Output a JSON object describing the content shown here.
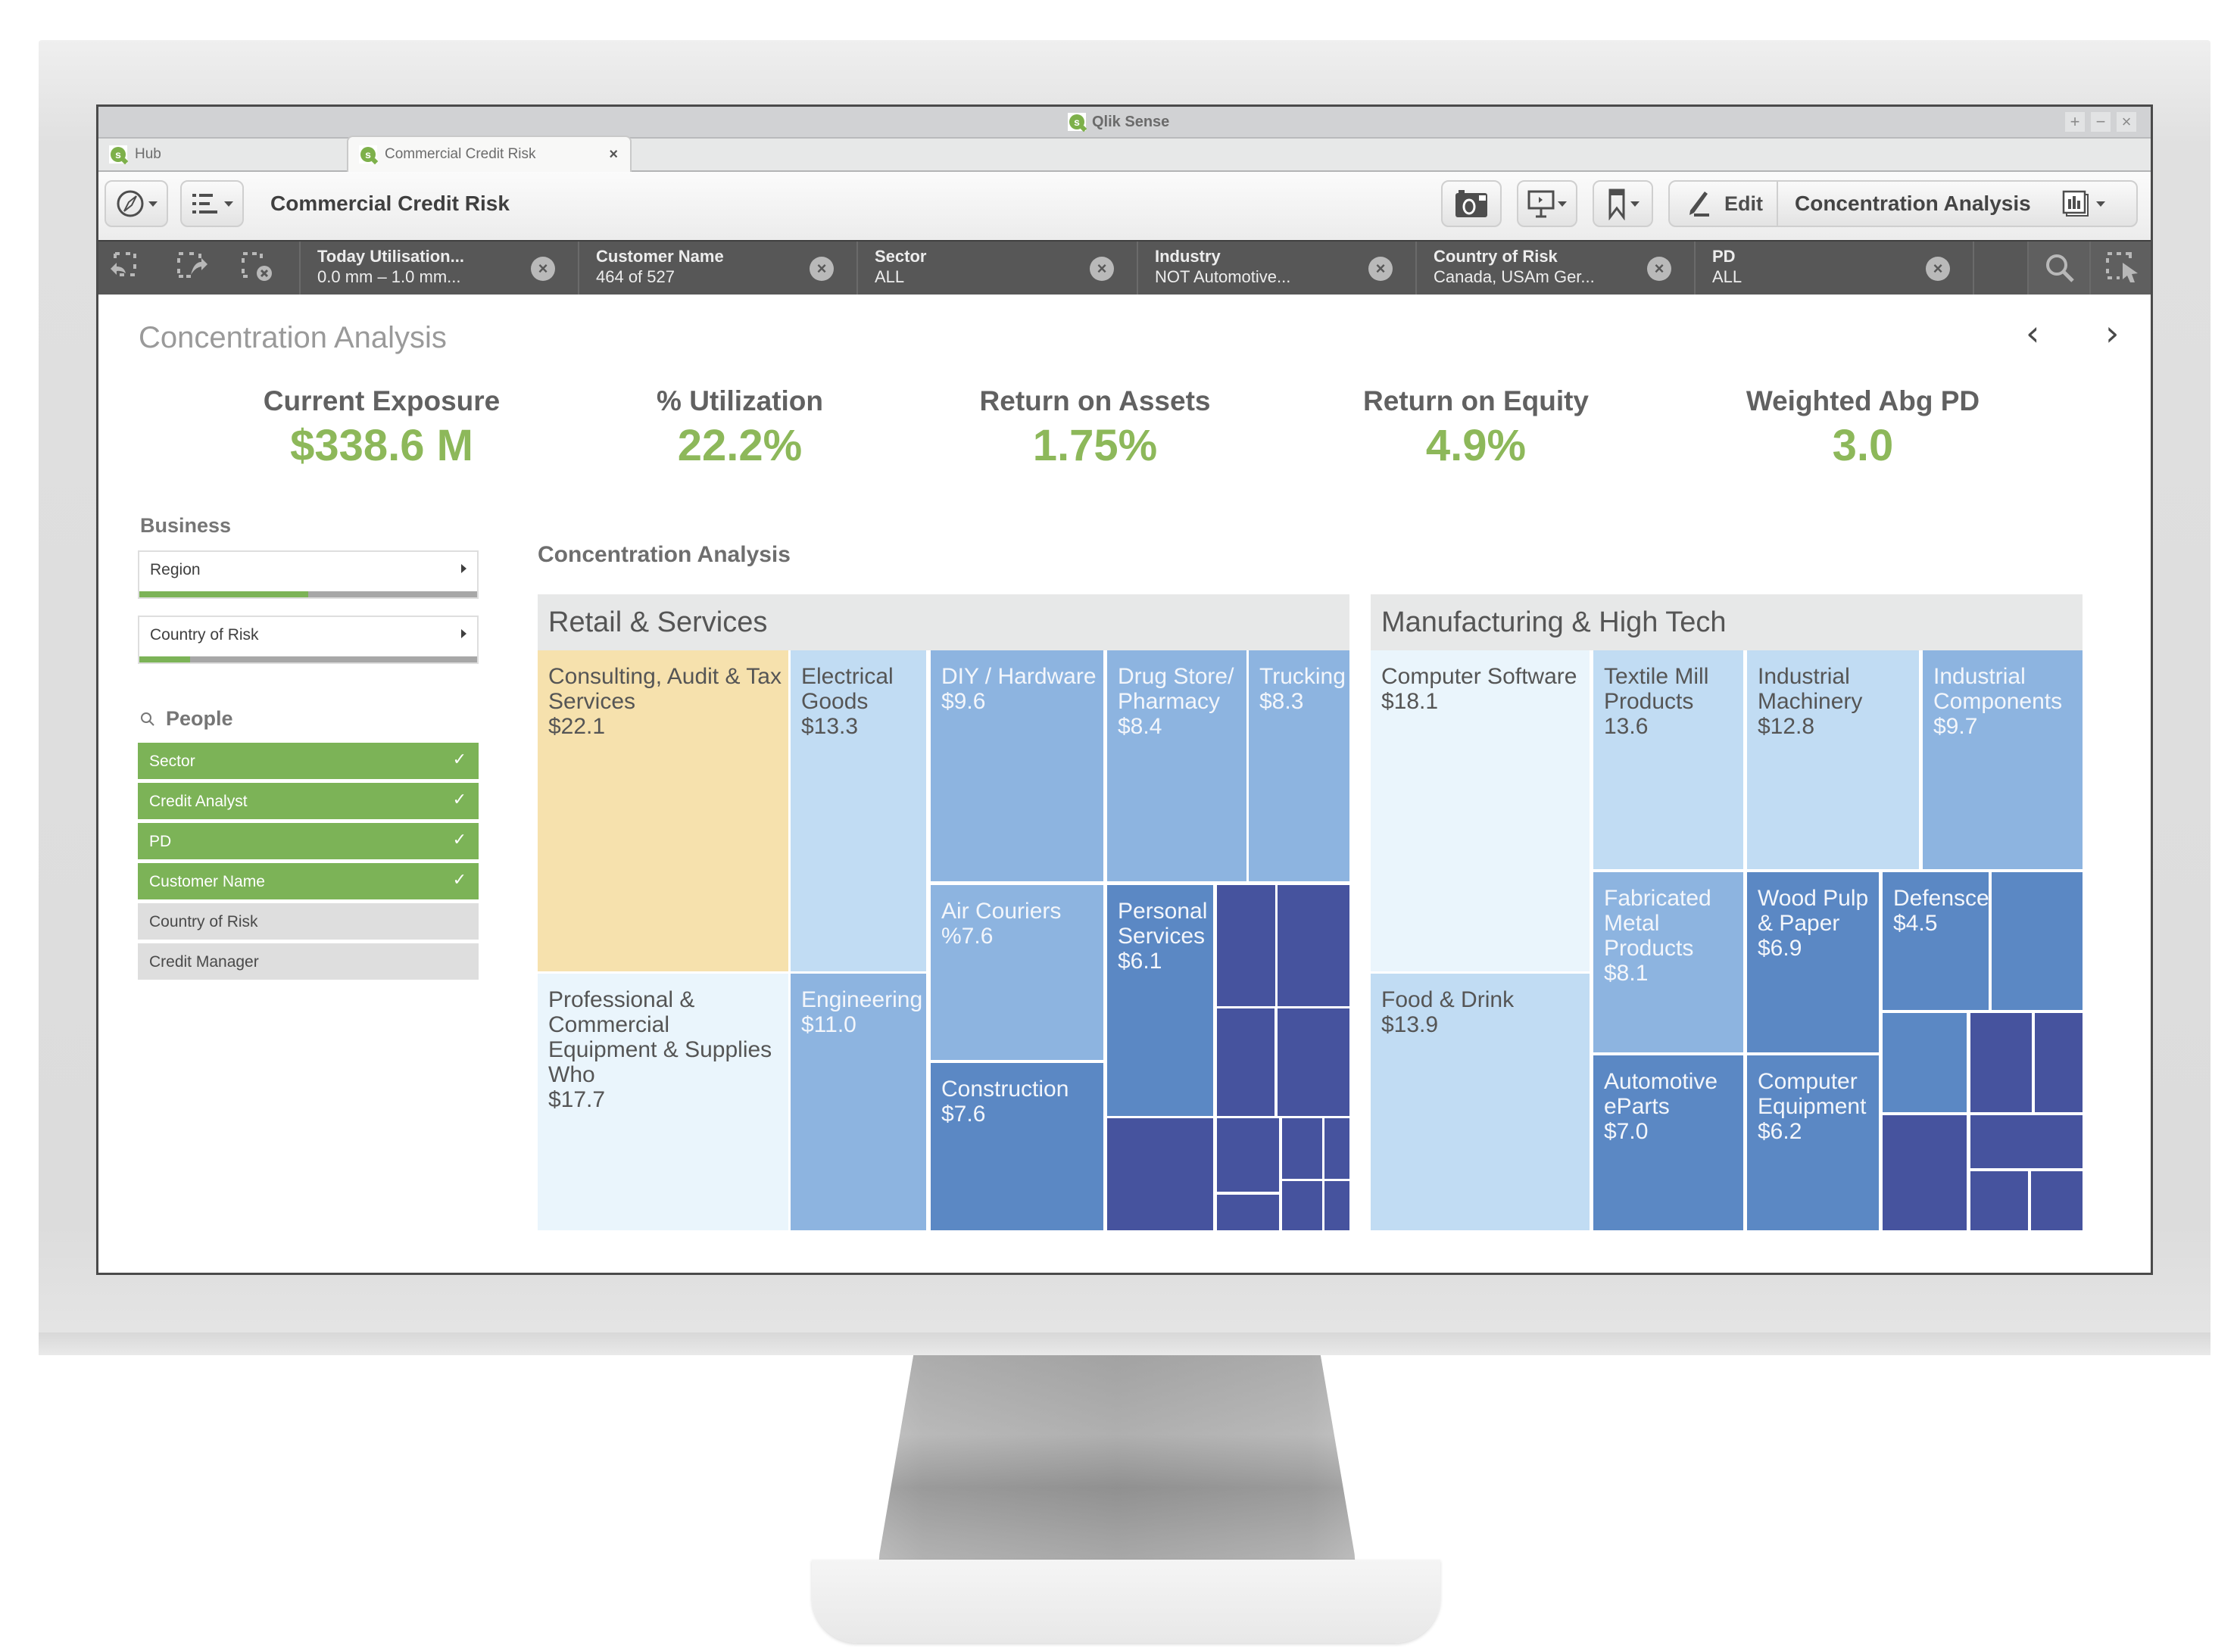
{
  "window": {
    "app_title": "Qlik Sense",
    "controls": [
      "+",
      "−",
      "×"
    ]
  },
  "tabs": [
    {
      "label": "Hub",
      "icon": "qlik-logo-icon",
      "active": false
    },
    {
      "label": "Commercial Credit Risk",
      "icon": "qlik-logo-icon",
      "active": true,
      "close": "×"
    }
  ],
  "toolbar": {
    "app_name": "Commercial Credit Risk",
    "navigate_icon": "compass-icon",
    "menu_icon": "list-icon",
    "snapshot_icon": "camera-icon",
    "storytelling_icon": "presentation-icon",
    "bookmark_icon": "bookmark-icon",
    "edit_label": "Edit",
    "sheet_name": "Concentration Analysis",
    "sheet_icon": "sheets-icon"
  },
  "filter_bar": {
    "selection_tools": [
      "step-back-icon",
      "step-forward-icon",
      "clear-all-icon"
    ],
    "chips": [
      {
        "label": "Today Utilisation...",
        "value": "0.0 mm – 1.0 mm..."
      },
      {
        "label": "Customer Name",
        "value": "464 of 527"
      },
      {
        "label": "Sector",
        "value": "ALL"
      },
      {
        "label": "Industry",
        "value": "NOT Automotive..."
      },
      {
        "label": "Country of Risk",
        "value": "Canada, USAm Ger..."
      },
      {
        "label": "PD",
        "value": "ALL"
      }
    ],
    "search_icon": "search-icon",
    "select_icon": "lasso-select-icon"
  },
  "sheet": {
    "title": "Concentration Analysis",
    "prev": "‹",
    "next": "›"
  },
  "kpis": [
    {
      "label": "Current Exposure",
      "value": "$338.6 M"
    },
    {
      "label": "% Utilization",
      "value": "22.2%"
    },
    {
      "label": "Return on Assets",
      "value": "1.75%"
    },
    {
      "label": "Return on Equity",
      "value": "4.9%"
    },
    {
      "label": "Weighted Abg PD",
      "value": "3.0"
    }
  ],
  "business": {
    "heading": "Business",
    "items": [
      {
        "label": "Region",
        "fill_pct": 50
      },
      {
        "label": "Country of Risk",
        "fill_pct": 15
      }
    ]
  },
  "people": {
    "heading": "People",
    "search_icon": "search-icon",
    "fields": [
      {
        "label": "Sector",
        "selected": true
      },
      {
        "label": "Credit Analyst",
        "selected": true
      },
      {
        "label": "PD",
        "selected": true
      },
      {
        "label": "Customer Name",
        "selected": true
      },
      {
        "label": "Country of Risk",
        "selected": false
      },
      {
        "label": "Credit Manager",
        "selected": false
      }
    ],
    "check": "✓"
  },
  "colors": {
    "accent_green": "#8db85a",
    "selected_green": "#7cb357",
    "tile_yellow": "#f6e1ad",
    "tile_palest": "#eaf5fc",
    "tile_pale": "#c1dcf3",
    "tile_light": "#8db4e0",
    "tile_mid": "#5b88c4",
    "tile_dark": "#46539e"
  },
  "chart_data": {
    "type": "treemap",
    "title": "Concentration Analysis",
    "value_unit": "$M",
    "groups": [
      {
        "name": "Retail & Services",
        "items": [
          {
            "label": "Consulting, Audit & Tax Services",
            "value_label": "$22.1",
            "value": 22.1,
            "color": "tile_yellow"
          },
          {
            "label": "Professional & Commercial Equipment & Supplies Who",
            "value_label": "$17.7",
            "value": 17.7,
            "color": "tile_palest"
          },
          {
            "label": "Electrical Goods",
            "value_label": "$13.3",
            "value": 13.3,
            "color": "tile_pale"
          },
          {
            "label": "Engineering",
            "value_label": "$11.0",
            "value": 11.0,
            "color": "tile_light"
          },
          {
            "label": "DIY / Hardware",
            "value_label": "$9.6",
            "value": 9.6,
            "color": "tile_light"
          },
          {
            "label": "Drug Store/ Pharmacy",
            "value_label": "$8.4",
            "value": 8.4,
            "color": "tile_light"
          },
          {
            "label": "Trucking",
            "value_label": "$8.3",
            "value": 8.3,
            "color": "tile_light"
          },
          {
            "label": "Air Couriers",
            "value_label": "%7.6",
            "value": 7.6,
            "color": "tile_light"
          },
          {
            "label": "Construction",
            "value_label": "$7.6",
            "value": 7.6,
            "color": "tile_mid"
          },
          {
            "label": "Personal Services",
            "value_label": "$6.1",
            "value": 6.1,
            "color": "tile_mid"
          },
          {
            "label": "",
            "value_label": "",
            "color": "tile_dark"
          },
          {
            "label": "",
            "value_label": "",
            "color": "tile_dark"
          },
          {
            "label": "",
            "value_label": "",
            "color": "tile_dark"
          },
          {
            "label": "",
            "value_label": "",
            "color": "tile_dark"
          },
          {
            "label": "",
            "value_label": "",
            "color": "tile_dark"
          },
          {
            "label": "",
            "value_label": "",
            "color": "tile_dark"
          },
          {
            "label": "",
            "value_label": "",
            "color": "tile_dark"
          },
          {
            "label": "",
            "value_label": "",
            "color": "tile_dark"
          },
          {
            "label": "",
            "value_label": "",
            "color": "tile_dark"
          },
          {
            "label": "",
            "value_label": "",
            "color": "tile_dark"
          },
          {
            "label": "",
            "value_label": "",
            "color": "tile_dark"
          }
        ]
      },
      {
        "name": "Manufacturing & High Tech",
        "items": [
          {
            "label": "Computer Software",
            "value_label": "$18.1",
            "value": 18.1,
            "color": "tile_palest"
          },
          {
            "label": "Food & Drink",
            "value_label": "$13.9",
            "value": 13.9,
            "color": "tile_pale"
          },
          {
            "label": "Textile Mill Products",
            "value_label": "13.6",
            "value": 13.6,
            "color": "tile_pale"
          },
          {
            "label": "Industrial Machinery",
            "value_label": "$12.8",
            "value": 12.8,
            "color": "tile_pale"
          },
          {
            "label": "Industrial Components",
            "value_label": "$9.7",
            "value": 9.7,
            "color": "tile_light"
          },
          {
            "label": "Fabricated Metal Products",
            "value_label": "$8.1",
            "value": 8.1,
            "color": "tile_light"
          },
          {
            "label": "Wood Pulp & Paper",
            "value_label": "$6.9",
            "value": 6.9,
            "color": "tile_mid"
          },
          {
            "label": "Automotive eParts",
            "value_label": "$7.0",
            "value": 7.0,
            "color": "tile_mid"
          },
          {
            "label": "Computer Equipment",
            "value_label": "$6.2",
            "value": 6.2,
            "color": "tile_mid"
          },
          {
            "label": "Defensce",
            "value_label": "$4.5",
            "value": 4.5,
            "color": "tile_mid"
          },
          {
            "label": "",
            "value_label": "",
            "color": "tile_mid"
          },
          {
            "label": "",
            "value_label": "",
            "color": "tile_mid"
          },
          {
            "label": "",
            "value_label": "",
            "color": "tile_dark"
          },
          {
            "label": "",
            "value_label": "",
            "color": "tile_dark"
          },
          {
            "label": "",
            "value_label": "",
            "color": "tile_dark"
          },
          {
            "label": "",
            "value_label": "",
            "color": "tile_dark"
          },
          {
            "label": "",
            "value_label": "",
            "color": "tile_dark"
          },
          {
            "label": "",
            "value_label": "",
            "color": "tile_dark"
          }
        ]
      }
    ]
  }
}
